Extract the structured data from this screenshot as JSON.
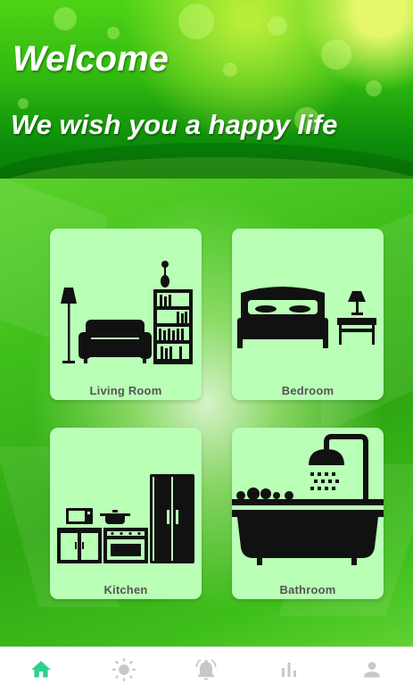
{
  "header": {
    "welcome": "Welcome",
    "tagline": "We wish you a happy life"
  },
  "rooms": [
    {
      "label": "Living Room",
      "icon": "living-room-icon"
    },
    {
      "label": "Bedroom",
      "icon": "bedroom-icon"
    },
    {
      "label": "Kitchen",
      "icon": "kitchen-icon"
    },
    {
      "label": "Bathroom",
      "icon": "bathroom-icon"
    }
  ],
  "nav": {
    "items": [
      {
        "icon": "home-icon",
        "active": true
      },
      {
        "icon": "light-icon",
        "active": false
      },
      {
        "icon": "notification-bell-icon",
        "active": false
      },
      {
        "icon": "statistics-icon",
        "active": false
      },
      {
        "icon": "profile-icon",
        "active": false
      }
    ]
  },
  "colors": {
    "card_bg": "#b9ffb6",
    "nav_active": "#2ecf8f",
    "nav_inactive": "#c8c8c8",
    "label_text": "#555555"
  }
}
